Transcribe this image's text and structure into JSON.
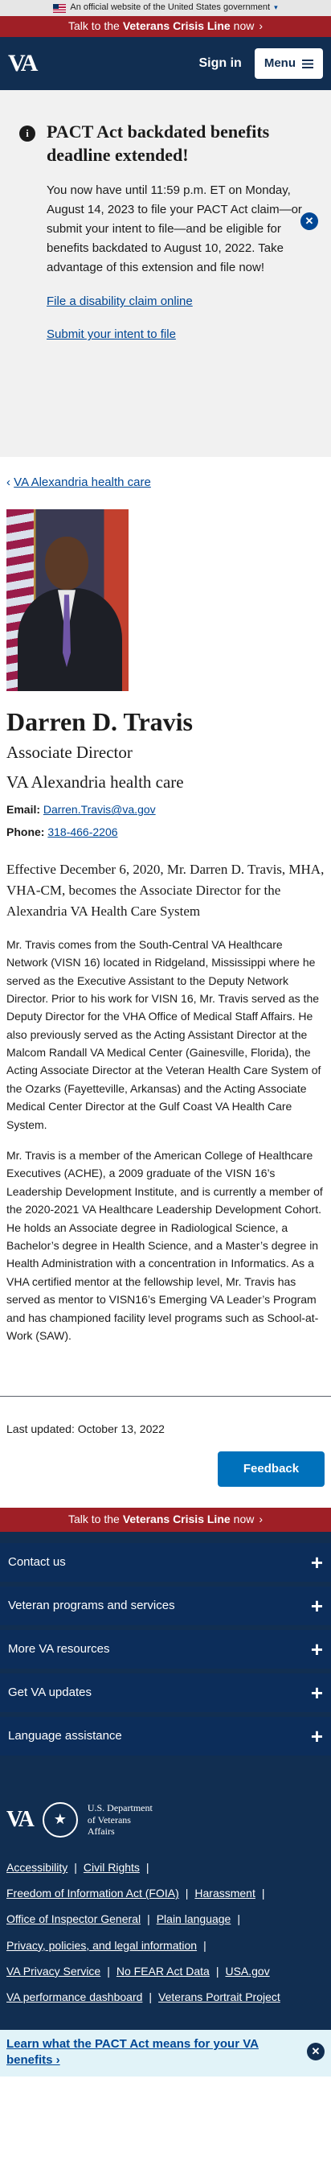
{
  "gov_banner": {
    "text": "An official website of the United States government",
    "icon": "chevron-down-icon"
  },
  "crisis_line": {
    "prefix": "Talk to the",
    "bold": "Veterans Crisis Line",
    "suffix": "now",
    "arrow": "›"
  },
  "header": {
    "logo": "VA",
    "signin": "Sign in",
    "menu": "Menu"
  },
  "alert": {
    "icon": "info-icon",
    "title": "PACT Act backdated benefits deadline extended!",
    "body": "You now have until 11:59 p.m. ET on Monday, August 14, 2023 to file your PACT Act claim—or submit your intent to file—and be eligible for benefits backdated to August 10, 2022. Take advantage of this extension and file now!",
    "link1": "File a disability claim online",
    "link2": "Submit your intent to file",
    "close": "✕"
  },
  "breadcrumb": {
    "back": "‹",
    "label": "VA Alexandria health care"
  },
  "profile": {
    "name": "Darren D. Travis",
    "role": "Associate Director",
    "facility": "VA Alexandria health care",
    "email_label": "Email:",
    "email": "Darren.Travis@va.gov",
    "phone_label": "Phone:",
    "phone": "318-466-2206"
  },
  "intro": "Effective December 6, 2020, Mr. Darren D. Travis, MHA, VHA-CM, becomes the Associate Director for the Alexandria VA Health Care System",
  "paragraphs": [
    "Mr. Travis comes from the South-Central VA Healthcare Network (VISN 16) located in Ridgeland, Mississippi where he served as the Executive Assistant to the Deputy Network Director. Prior to his work for VISN 16, Mr. Travis served as the Deputy Director for the VHA Office of Medical Staff Affairs.  He also previously served as the Acting Assistant Director at the Malcom Randall VA Medical Center (Gainesville, Florida), the Acting Associate Director at the Veteran Health Care System of the Ozarks (Fayetteville, Arkansas) and the Acting Associate Medical Center Director  at the Gulf Coast VA Health Care System.",
    "Mr. Travis is a member of the American College of Healthcare Executives (ACHE), a  2009 graduate of the VISN 16’s Leadership Development Institute, and  is currently a member of the 2020-2021 VA Healthcare Leadership Development Cohort.  He holds an Associate degree in Radiological Science, a Bachelor’s degree in Health Science, and a Master’s degree in Health Administration with a concentration in Informatics.  As a VHA certified mentor at the fellowship level, Mr. Travis has served as mentor to VISN16’s Emerging VA Leader’s Program and has championed facility level programs such as School-at-Work (SAW)."
  ],
  "last_updated": "Last updated: October 13, 2022",
  "feedback": "Feedback",
  "footer": {
    "accordions": [
      "Contact us",
      "Veteran programs and services",
      "More VA resources",
      "Get VA updates",
      "Language assistance"
    ],
    "plus": "+",
    "logo": "VA",
    "dept": "U.S. Department of Veterans Affairs",
    "links": [
      [
        "Accessibility",
        "Civil Rights"
      ],
      [
        "Freedom of Information Act (FOIA)",
        "Harassment"
      ],
      [
        "Office of Inspector General",
        "Plain language"
      ],
      [
        "Privacy, policies, and legal information"
      ],
      [
        "VA Privacy Service",
        "No FEAR Act Data",
        "USA.gov"
      ],
      [
        "VA performance dashboard",
        "Veterans Portrait Project"
      ]
    ],
    "separator": "|"
  },
  "pact_banner": {
    "text": "Learn what the PACT Act means for your VA benefits ›",
    "close": "✕"
  },
  "colors": {
    "header": "#112e51",
    "crisis": "#9f1f26",
    "link": "#004795",
    "feedback": "#0071bb"
  }
}
